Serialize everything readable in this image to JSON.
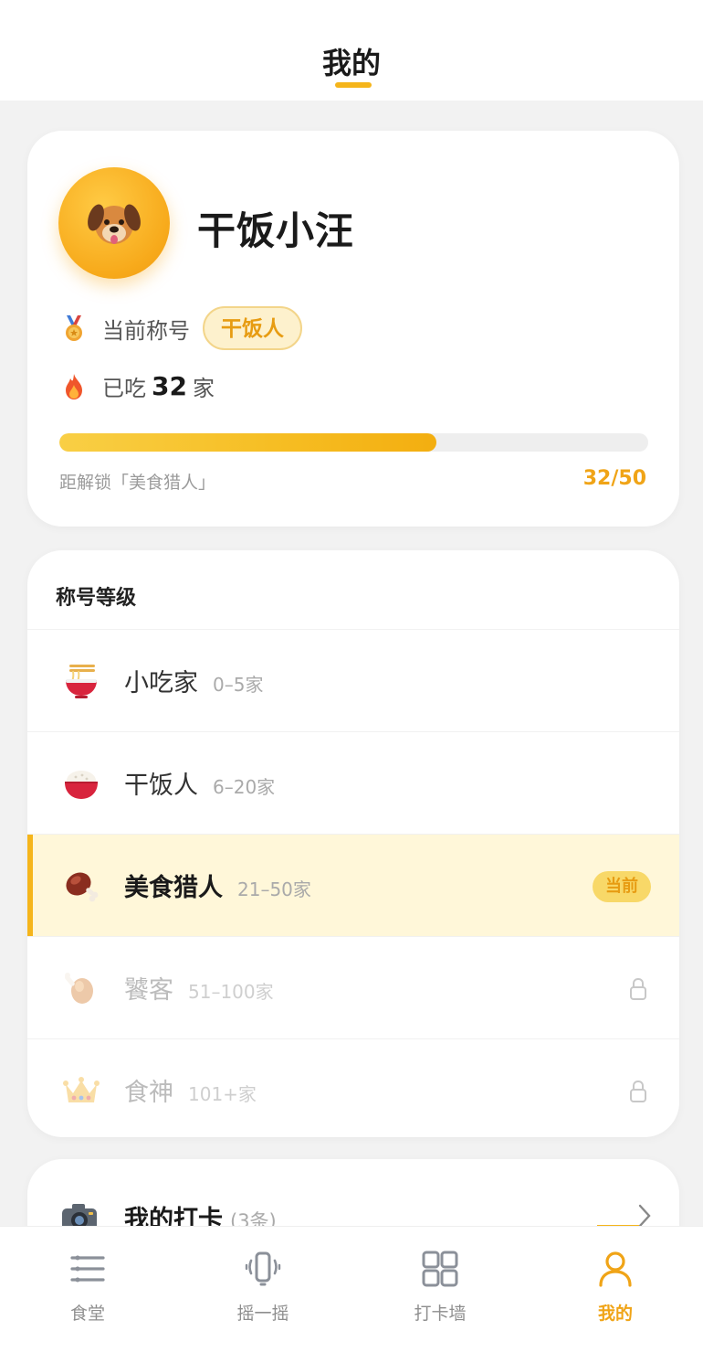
{
  "header": {
    "title": "我的"
  },
  "profile": {
    "avatar_icon": "dog-face-icon",
    "username": "干饭小汪",
    "title_label": "当前称号",
    "title_value": "干饭人",
    "count_prefix": "已吃",
    "count_value": "32",
    "count_suffix": "家",
    "progress": {
      "current": 32,
      "total": 50,
      "fraction": 0.64
    },
    "progress_hint": "距解锁「美食猎人」",
    "progress_text": "32/50"
  },
  "levels": {
    "header": "称号等级",
    "items": [
      {
        "icon": "noodle-bowl-icon",
        "name": "小吃家",
        "range": "0–5家"
      },
      {
        "icon": "rice-bowl-icon",
        "name": "干饭人",
        "range": "6–20家"
      },
      {
        "icon": "meat-on-bone-icon",
        "name": "美食猎人",
        "range": "21–50家",
        "badge": "当前"
      },
      {
        "icon": "poultry-leg-icon",
        "name": "饕客",
        "range": "51–100家",
        "locked": true
      },
      {
        "icon": "crown-icon",
        "name": "食神",
        "range": "101+家",
        "locked": true
      }
    ]
  },
  "checkins": {
    "icon": "camera-icon",
    "title": "我的打卡",
    "count": "(3条)"
  },
  "tabbar": {
    "items": [
      {
        "icon": "menu-lines-icon",
        "label": "食堂"
      },
      {
        "icon": "shake-phone-icon",
        "label": "摇一摇"
      },
      {
        "icon": "grid-icon",
        "label": "打卡墙"
      },
      {
        "icon": "user-icon",
        "label": "我的",
        "active": true
      }
    ]
  },
  "colors": {
    "accent": "#f5b51b",
    "accent_text": "#f0a417",
    "current_row_bg": "#fff7d9"
  }
}
